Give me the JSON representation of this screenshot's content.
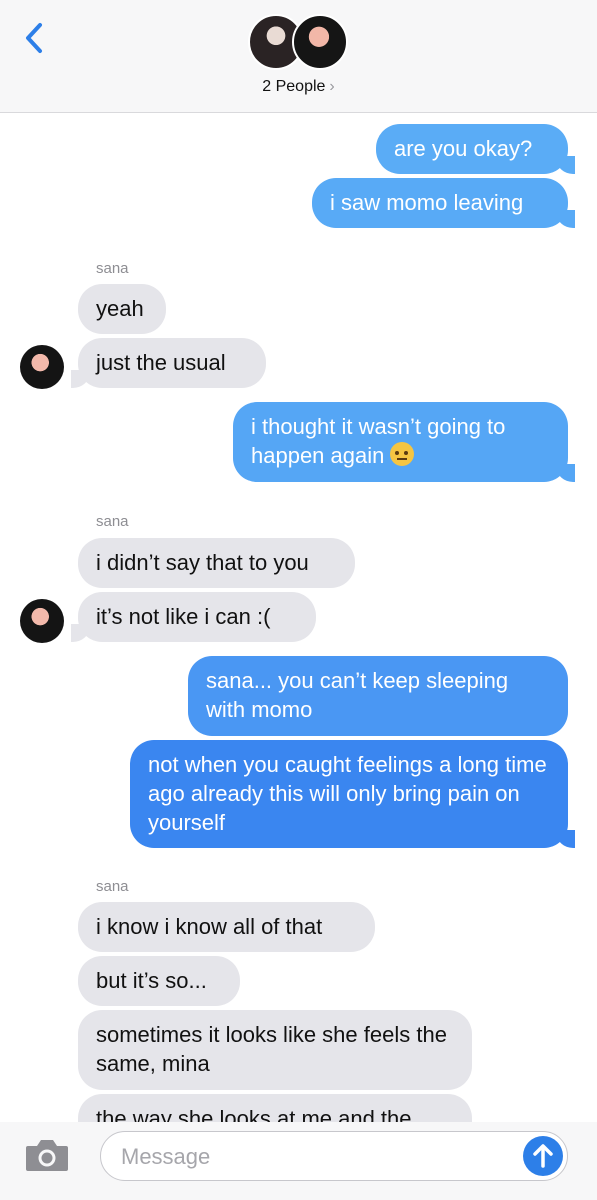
{
  "header": {
    "participants_label": "2 People",
    "chevron": "›"
  },
  "colors": {
    "outgoing_light": "#5aacf6",
    "outgoing_dark": "#3a86f0",
    "incoming": "#e5e5ea",
    "accent": "#2d7fe8"
  },
  "messages": [
    {
      "dir": "out",
      "text": "are you okay?"
    },
    {
      "dir": "out",
      "text": "i saw momo leaving"
    },
    {
      "dir": "sender",
      "text": "sana"
    },
    {
      "dir": "in",
      "text": "yeah"
    },
    {
      "dir": "in",
      "text": "just the usual"
    },
    {
      "dir": "out",
      "text": "i thought it wasn’t going to happen again",
      "emoji": "raised-eyebrow-emoji"
    },
    {
      "dir": "sender",
      "text": "sana"
    },
    {
      "dir": "in",
      "text": "i didn’t say that to you"
    },
    {
      "dir": "in",
      "text": "it’s not like i can :("
    },
    {
      "dir": "out",
      "text": "sana... you can’t keep sleeping with momo"
    },
    {
      "dir": "out",
      "text": "not when you caught feelings a long time ago already this will only bring pain on yourself"
    },
    {
      "dir": "sender",
      "text": "sana"
    },
    {
      "dir": "in",
      "text": "i know i know all of that"
    },
    {
      "dir": "in",
      "text": "but it’s so..."
    },
    {
      "dir": "in",
      "text": "sometimes it looks like she feels the same, mina"
    },
    {
      "dir": "in",
      "text": "the way she looks at me and the"
    }
  ],
  "composer": {
    "placeholder": "Message"
  }
}
